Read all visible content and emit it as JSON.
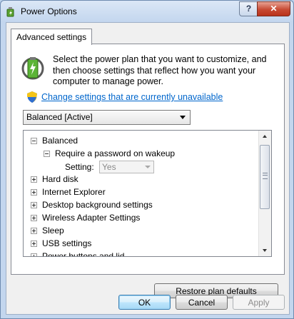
{
  "window": {
    "title": "Power Options",
    "help_label": "?",
    "close_label": "✕"
  },
  "tab": {
    "label": "Advanced settings"
  },
  "description": "Select the power plan that you want to customize, and then choose settings that reflect how you want your computer to manage power.",
  "change_link": "Change settings that are currently unavailable",
  "plan_select": {
    "value": "Balanced [Active]"
  },
  "tree": {
    "root": "Balanced",
    "child": "Require a password on wakeup",
    "setting_label": "Setting:",
    "setting_value": "Yes",
    "items": [
      "Hard disk",
      "Internet Explorer",
      "Desktop background settings",
      "Wireless Adapter Settings",
      "Sleep",
      "USB settings",
      "Power buttons and lid"
    ]
  },
  "buttons": {
    "restore": "Restore plan defaults",
    "ok": "OK",
    "cancel": "Cancel",
    "apply": "Apply"
  },
  "colors": {
    "link": "#0066cc",
    "title_bar": "#c3d6ee",
    "close": "#c74a33"
  }
}
